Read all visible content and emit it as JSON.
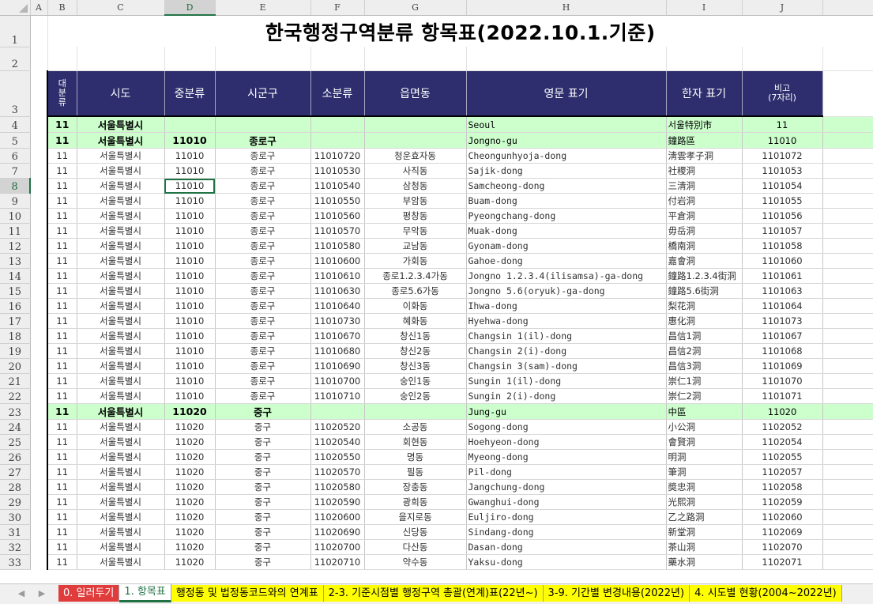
{
  "column_letters": [
    "A",
    "B",
    "C",
    "D",
    "E",
    "F",
    "G",
    "H",
    "I",
    "J"
  ],
  "selected_column": "D",
  "selected_row": "8",
  "title": "한국행정구역분류 항목표(2022.10.1.기준)",
  "title_row": "1",
  "blank_row": "2",
  "header_row": "3",
  "headers": {
    "b": "대\n분\n류",
    "c": "시도",
    "d": "중분류",
    "e": "시군구",
    "f": "소분류",
    "g": "읍면동",
    "h": "영문 표기",
    "i": "한자 표기",
    "j": "비고\n(7자리)"
  },
  "rows": [
    {
      "row": "4",
      "b": "11",
      "c": "서울특별시",
      "d": "",
      "e": "",
      "f": "",
      "g": "",
      "h": "Seoul",
      "i": "서울特別市",
      "j": "11",
      "hl": true
    },
    {
      "row": "5",
      "b": "11",
      "c": "서울특별시",
      "d": "11010",
      "e": "종로구",
      "f": "",
      "g": "",
      "h": "Jongno-gu",
      "i": "鐘路區",
      "j": "11010",
      "hl": true
    },
    {
      "row": "6",
      "b": "11",
      "c": "서울특별시",
      "d": "11010",
      "e": "종로구",
      "f": "11010720",
      "g": "청운효자동",
      "h": "Cheongunhyoja-dong",
      "i": "淸雲孝子洞",
      "j": "1101072"
    },
    {
      "row": "7",
      "b": "11",
      "c": "서울특별시",
      "d": "11010",
      "e": "종로구",
      "f": "11010530",
      "g": "사직동",
      "h": "Sajik-dong",
      "i": "社稷洞",
      "j": "1101053"
    },
    {
      "row": "8",
      "b": "11",
      "c": "서울특별시",
      "d": "11010",
      "e": "종로구",
      "f": "11010540",
      "g": "삼청동",
      "h": "Samcheong-dong",
      "i": "三淸洞",
      "j": "1101054"
    },
    {
      "row": "9",
      "b": "11",
      "c": "서울특별시",
      "d": "11010",
      "e": "종로구",
      "f": "11010550",
      "g": "부암동",
      "h": "Buam-dong",
      "i": "付岩洞",
      "j": "1101055"
    },
    {
      "row": "10",
      "b": "11",
      "c": "서울특별시",
      "d": "11010",
      "e": "종로구",
      "f": "11010560",
      "g": "평창동",
      "h": "Pyeongchang-dong",
      "i": "平倉洞",
      "j": "1101056"
    },
    {
      "row": "11",
      "b": "11",
      "c": "서울특별시",
      "d": "11010",
      "e": "종로구",
      "f": "11010570",
      "g": "무악동",
      "h": "Muak-dong",
      "i": "毋岳洞",
      "j": "1101057"
    },
    {
      "row": "12",
      "b": "11",
      "c": "서울특별시",
      "d": "11010",
      "e": "종로구",
      "f": "11010580",
      "g": "교남동",
      "h": "Gyonam-dong",
      "i": "橋南洞",
      "j": "1101058"
    },
    {
      "row": "13",
      "b": "11",
      "c": "서울특별시",
      "d": "11010",
      "e": "종로구",
      "f": "11010600",
      "g": "가회동",
      "h": "Gahoe-dong",
      "i": "嘉會洞",
      "j": "1101060"
    },
    {
      "row": "14",
      "b": "11",
      "c": "서울특별시",
      "d": "11010",
      "e": "종로구",
      "f": "11010610",
      "g": "종로1.2.3.4가동",
      "h": "Jongno 1.2.3.4(ilisamsa)-ga-dong",
      "i": "鐘路1.2.3.4街洞",
      "j": "1101061"
    },
    {
      "row": "15",
      "b": "11",
      "c": "서울특별시",
      "d": "11010",
      "e": "종로구",
      "f": "11010630",
      "g": "종로5.6가동",
      "h": "Jongno 5.6(oryuk)-ga-dong",
      "i": "鐘路5.6街洞",
      "j": "1101063"
    },
    {
      "row": "16",
      "b": "11",
      "c": "서울특별시",
      "d": "11010",
      "e": "종로구",
      "f": "11010640",
      "g": "이화동",
      "h": "Ihwa-dong",
      "i": "梨花洞",
      "j": "1101064"
    },
    {
      "row": "17",
      "b": "11",
      "c": "서울특별시",
      "d": "11010",
      "e": "종로구",
      "f": "11010730",
      "g": "혜화동",
      "h": "Hyehwa-dong",
      "i": "惠化洞",
      "j": "1101073"
    },
    {
      "row": "18",
      "b": "11",
      "c": "서울특별시",
      "d": "11010",
      "e": "종로구",
      "f": "11010670",
      "g": "창신1동",
      "h": "Changsin 1(il)-dong",
      "i": "昌信1洞",
      "j": "1101067"
    },
    {
      "row": "19",
      "b": "11",
      "c": "서울특별시",
      "d": "11010",
      "e": "종로구",
      "f": "11010680",
      "g": "창신2동",
      "h": "Changsin 2(i)-dong",
      "i": "昌信2洞",
      "j": "1101068"
    },
    {
      "row": "20",
      "b": "11",
      "c": "서울특별시",
      "d": "11010",
      "e": "종로구",
      "f": "11010690",
      "g": "창신3동",
      "h": "Changsin 3(sam)-dong",
      "i": "昌信3洞",
      "j": "1101069"
    },
    {
      "row": "21",
      "b": "11",
      "c": "서울특별시",
      "d": "11010",
      "e": "종로구",
      "f": "11010700",
      "g": "숭인1동",
      "h": "Sungin 1(il)-dong",
      "i": "崇仁1洞",
      "j": "1101070"
    },
    {
      "row": "22",
      "b": "11",
      "c": "서울특별시",
      "d": "11010",
      "e": "종로구",
      "f": "11010710",
      "g": "숭인2동",
      "h": "Sungin 2(i)-dong",
      "i": "崇仁2洞",
      "j": "1101071"
    },
    {
      "row": "23",
      "b": "11",
      "c": "서울특별시",
      "d": "11020",
      "e": "중구",
      "f": "",
      "g": "",
      "h": "Jung-gu",
      "i": "中區",
      "j": "11020",
      "hl": true
    },
    {
      "row": "24",
      "b": "11",
      "c": "서울특별시",
      "d": "11020",
      "e": "중구",
      "f": "11020520",
      "g": "소공동",
      "h": "Sogong-dong",
      "i": "小公洞",
      "j": "1102052"
    },
    {
      "row": "25",
      "b": "11",
      "c": "서울특별시",
      "d": "11020",
      "e": "중구",
      "f": "11020540",
      "g": "회현동",
      "h": "Hoehyeon-dong",
      "i": "會賢洞",
      "j": "1102054"
    },
    {
      "row": "26",
      "b": "11",
      "c": "서울특별시",
      "d": "11020",
      "e": "중구",
      "f": "11020550",
      "g": "명동",
      "h": "Myeong-dong",
      "i": "明洞",
      "j": "1102055"
    },
    {
      "row": "27",
      "b": "11",
      "c": "서울특별시",
      "d": "11020",
      "e": "중구",
      "f": "11020570",
      "g": "필동",
      "h": "Pil-dong",
      "i": "筆洞",
      "j": "1102057"
    },
    {
      "row": "28",
      "b": "11",
      "c": "서울특별시",
      "d": "11020",
      "e": "중구",
      "f": "11020580",
      "g": "장충동",
      "h": "Jangchung-dong",
      "i": "奬忠洞",
      "j": "1102058"
    },
    {
      "row": "29",
      "b": "11",
      "c": "서울특별시",
      "d": "11020",
      "e": "중구",
      "f": "11020590",
      "g": "광희동",
      "h": "Gwanghui-dong",
      "i": "光熙洞",
      "j": "1102059"
    },
    {
      "row": "30",
      "b": "11",
      "c": "서울특별시",
      "d": "11020",
      "e": "중구",
      "f": "11020600",
      "g": "을지로동",
      "h": "Euljiro-dong",
      "i": "乙之路洞",
      "j": "1102060"
    },
    {
      "row": "31",
      "b": "11",
      "c": "서울특별시",
      "d": "11020",
      "e": "중구",
      "f": "11020690",
      "g": "신당동",
      "h": "Sindang-dong",
      "i": "新堂洞",
      "j": "1102069"
    },
    {
      "row": "32",
      "b": "11",
      "c": "서울특별시",
      "d": "11020",
      "e": "중구",
      "f": "11020700",
      "g": "다산동",
      "h": "Dasan-dong",
      "i": "茶山洞",
      "j": "1102070"
    },
    {
      "row": "33",
      "b": "11",
      "c": "서울특별시",
      "d": "11020",
      "e": "중구",
      "f": "11020710",
      "g": "약수동",
      "h": "Yaksu-dong",
      "i": "藥水洞",
      "j": "1102071"
    }
  ],
  "sheet_tabs": [
    {
      "label": "0. 일러두기",
      "style": "red"
    },
    {
      "label": "1. 항목표",
      "style": "active"
    },
    {
      "label": "행정동 및 법정동코드와의 연계표",
      "style": "yellow"
    },
    {
      "label": "2-3. 기준시점별 행정구역 총괄(연계)표(22년~)",
      "style": "yellow"
    },
    {
      "label": "3-9. 기간별 변경내용(2022년)",
      "style": "yellow"
    },
    {
      "label": "4. 시도별 현황(2004~2022년)",
      "style": "yellow"
    }
  ],
  "nav": {
    "prev": "◀",
    "next": "▶"
  },
  "colors": {
    "header_bg": "#2e2e6e",
    "highlight_bg": "#ccffcc",
    "selection": "#217346",
    "tab_red": "#e03c3c",
    "tab_yellow": "#ffff00"
  }
}
